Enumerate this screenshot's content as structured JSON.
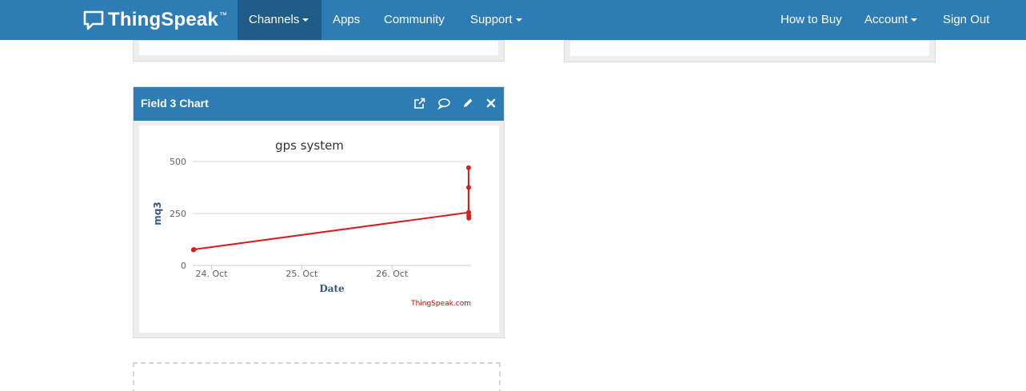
{
  "navbar": {
    "brand": "ThingSpeak",
    "brand_tm": "™",
    "channels": "Channels",
    "apps": "Apps",
    "community": "Community",
    "support": "Support",
    "how_to_buy": "How to Buy",
    "account": "Account",
    "sign_out": "Sign Out"
  },
  "chart_panel": {
    "title": "Field 3 Chart",
    "icons": [
      "external-link-icon",
      "comment-icon",
      "pencil-icon",
      "close-icon"
    ]
  },
  "colors": {
    "navbar": "#2e7cb4",
    "navbar_active": "#1f5c88",
    "series": "#d62020",
    "axis_title": "#34568b"
  },
  "chart_data": {
    "type": "line",
    "title": "gps system",
    "xlabel": "Date",
    "ylabel": "mq3",
    "credit": "ThingSpeak.com",
    "ylim": [
      0,
      500
    ],
    "yticks": [
      0,
      250,
      500
    ],
    "xlim": [
      "2023-10-23T19:00",
      "2023-10-26T21:00"
    ],
    "xticks": [
      {
        "label": "24. Oct",
        "date": "2023-10-24T00:00"
      },
      {
        "label": "25. Oct",
        "date": "2023-10-25T00:00"
      },
      {
        "label": "26. Oct",
        "date": "2023-10-26T00:00"
      }
    ],
    "grid": true,
    "series": [
      {
        "points": [
          {
            "x": "2023-10-23T19:10",
            "y": 75
          },
          {
            "x": "2023-10-23T19:20",
            "y": 77
          },
          {
            "x": "2023-10-26T20:20",
            "y": 255
          },
          {
            "x": "2023-10-26T20:21",
            "y": 470
          },
          {
            "x": "2023-10-26T20:22",
            "y": 375
          },
          {
            "x": "2023-10-26T20:23",
            "y": 255
          },
          {
            "x": "2023-10-26T20:24",
            "y": 240
          },
          {
            "x": "2023-10-26T20:25",
            "y": 228
          }
        ]
      }
    ]
  }
}
